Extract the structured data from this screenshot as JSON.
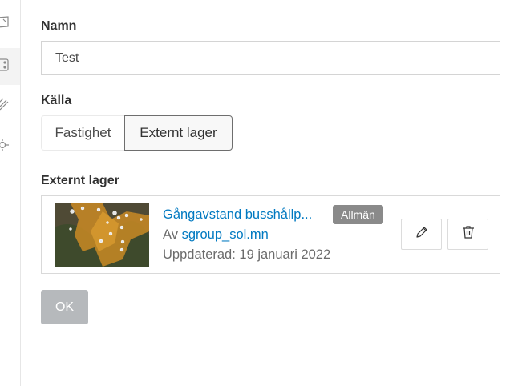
{
  "sidebar": {
    "icons": [
      "map-icon",
      "layers-icon",
      "draw-icon",
      "settings-icon"
    ]
  },
  "form": {
    "name_label": "Namn",
    "name_value": "Test",
    "source_label": "Källa",
    "source_options": [
      "Fastighet",
      "Externt lager"
    ],
    "source_selected": "Externt lager",
    "external_layer_label": "Externt lager"
  },
  "layer_card": {
    "title": "Gångavstand busshållp...",
    "badge": "Allmän",
    "owner_prefix": "Av",
    "owner": "sgroup_sol.mn",
    "updated": "Uppdaterad: 19 januari 2022"
  },
  "buttons": {
    "ok_label": "OK"
  },
  "colors": {
    "link": "#0079c1",
    "badge_bg": "#8a8a8a",
    "ok_disabled_bg": "#b6b9bc",
    "border": "#d4d4d4"
  }
}
